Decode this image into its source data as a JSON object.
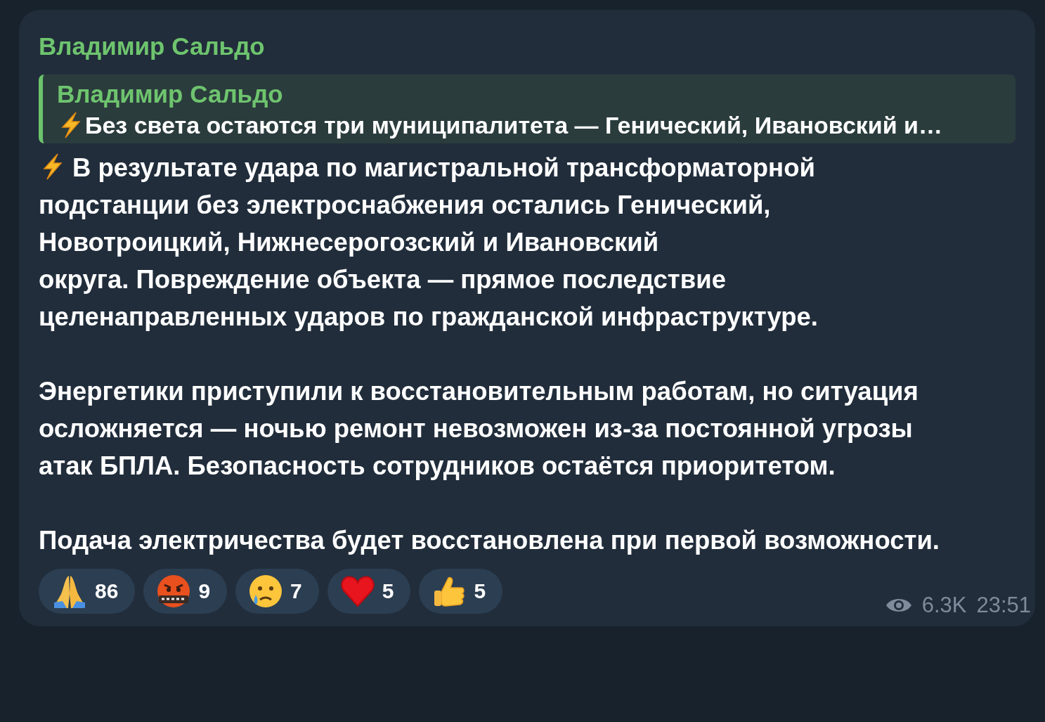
{
  "message": {
    "author": "Владимир Сальдо",
    "reply": {
      "author": "Владимир Сальдо",
      "kind": "lightning",
      "text": "Без света остаются три муниципалитета — Генический, Ивановский и…"
    },
    "paragraphs": [
      {
        "kind": "lightning",
        "text": "В результате удара по магистральной трансформаторной подстанции без электроснабжения остались Генический, Новотроицкий, Нижнесерогозский и Ивановский\nокруга. Повреждение объекта — прямое последствие целенаправленных ударов по гражданской инфраструктуре."
      },
      {
        "text": "Энергетики приступили к восстановительным работам, но ситуация осложняется — ночью ремонт невозможен из-за постоянной угрозы атак БПЛА. Безопасность сотрудников остаётся приоритетом."
      },
      {
        "text": "Подача электричества будет восстановлена при первой возможности."
      }
    ],
    "reactions": [
      {
        "kind": "pray",
        "count": "86"
      },
      {
        "kind": "angry",
        "count": "9"
      },
      {
        "kind": "cry",
        "count": "7"
      },
      {
        "kind": "heart",
        "count": "5"
      },
      {
        "kind": "thumbs",
        "count": "5"
      }
    ],
    "views": "6.3K",
    "time": "23:51"
  }
}
